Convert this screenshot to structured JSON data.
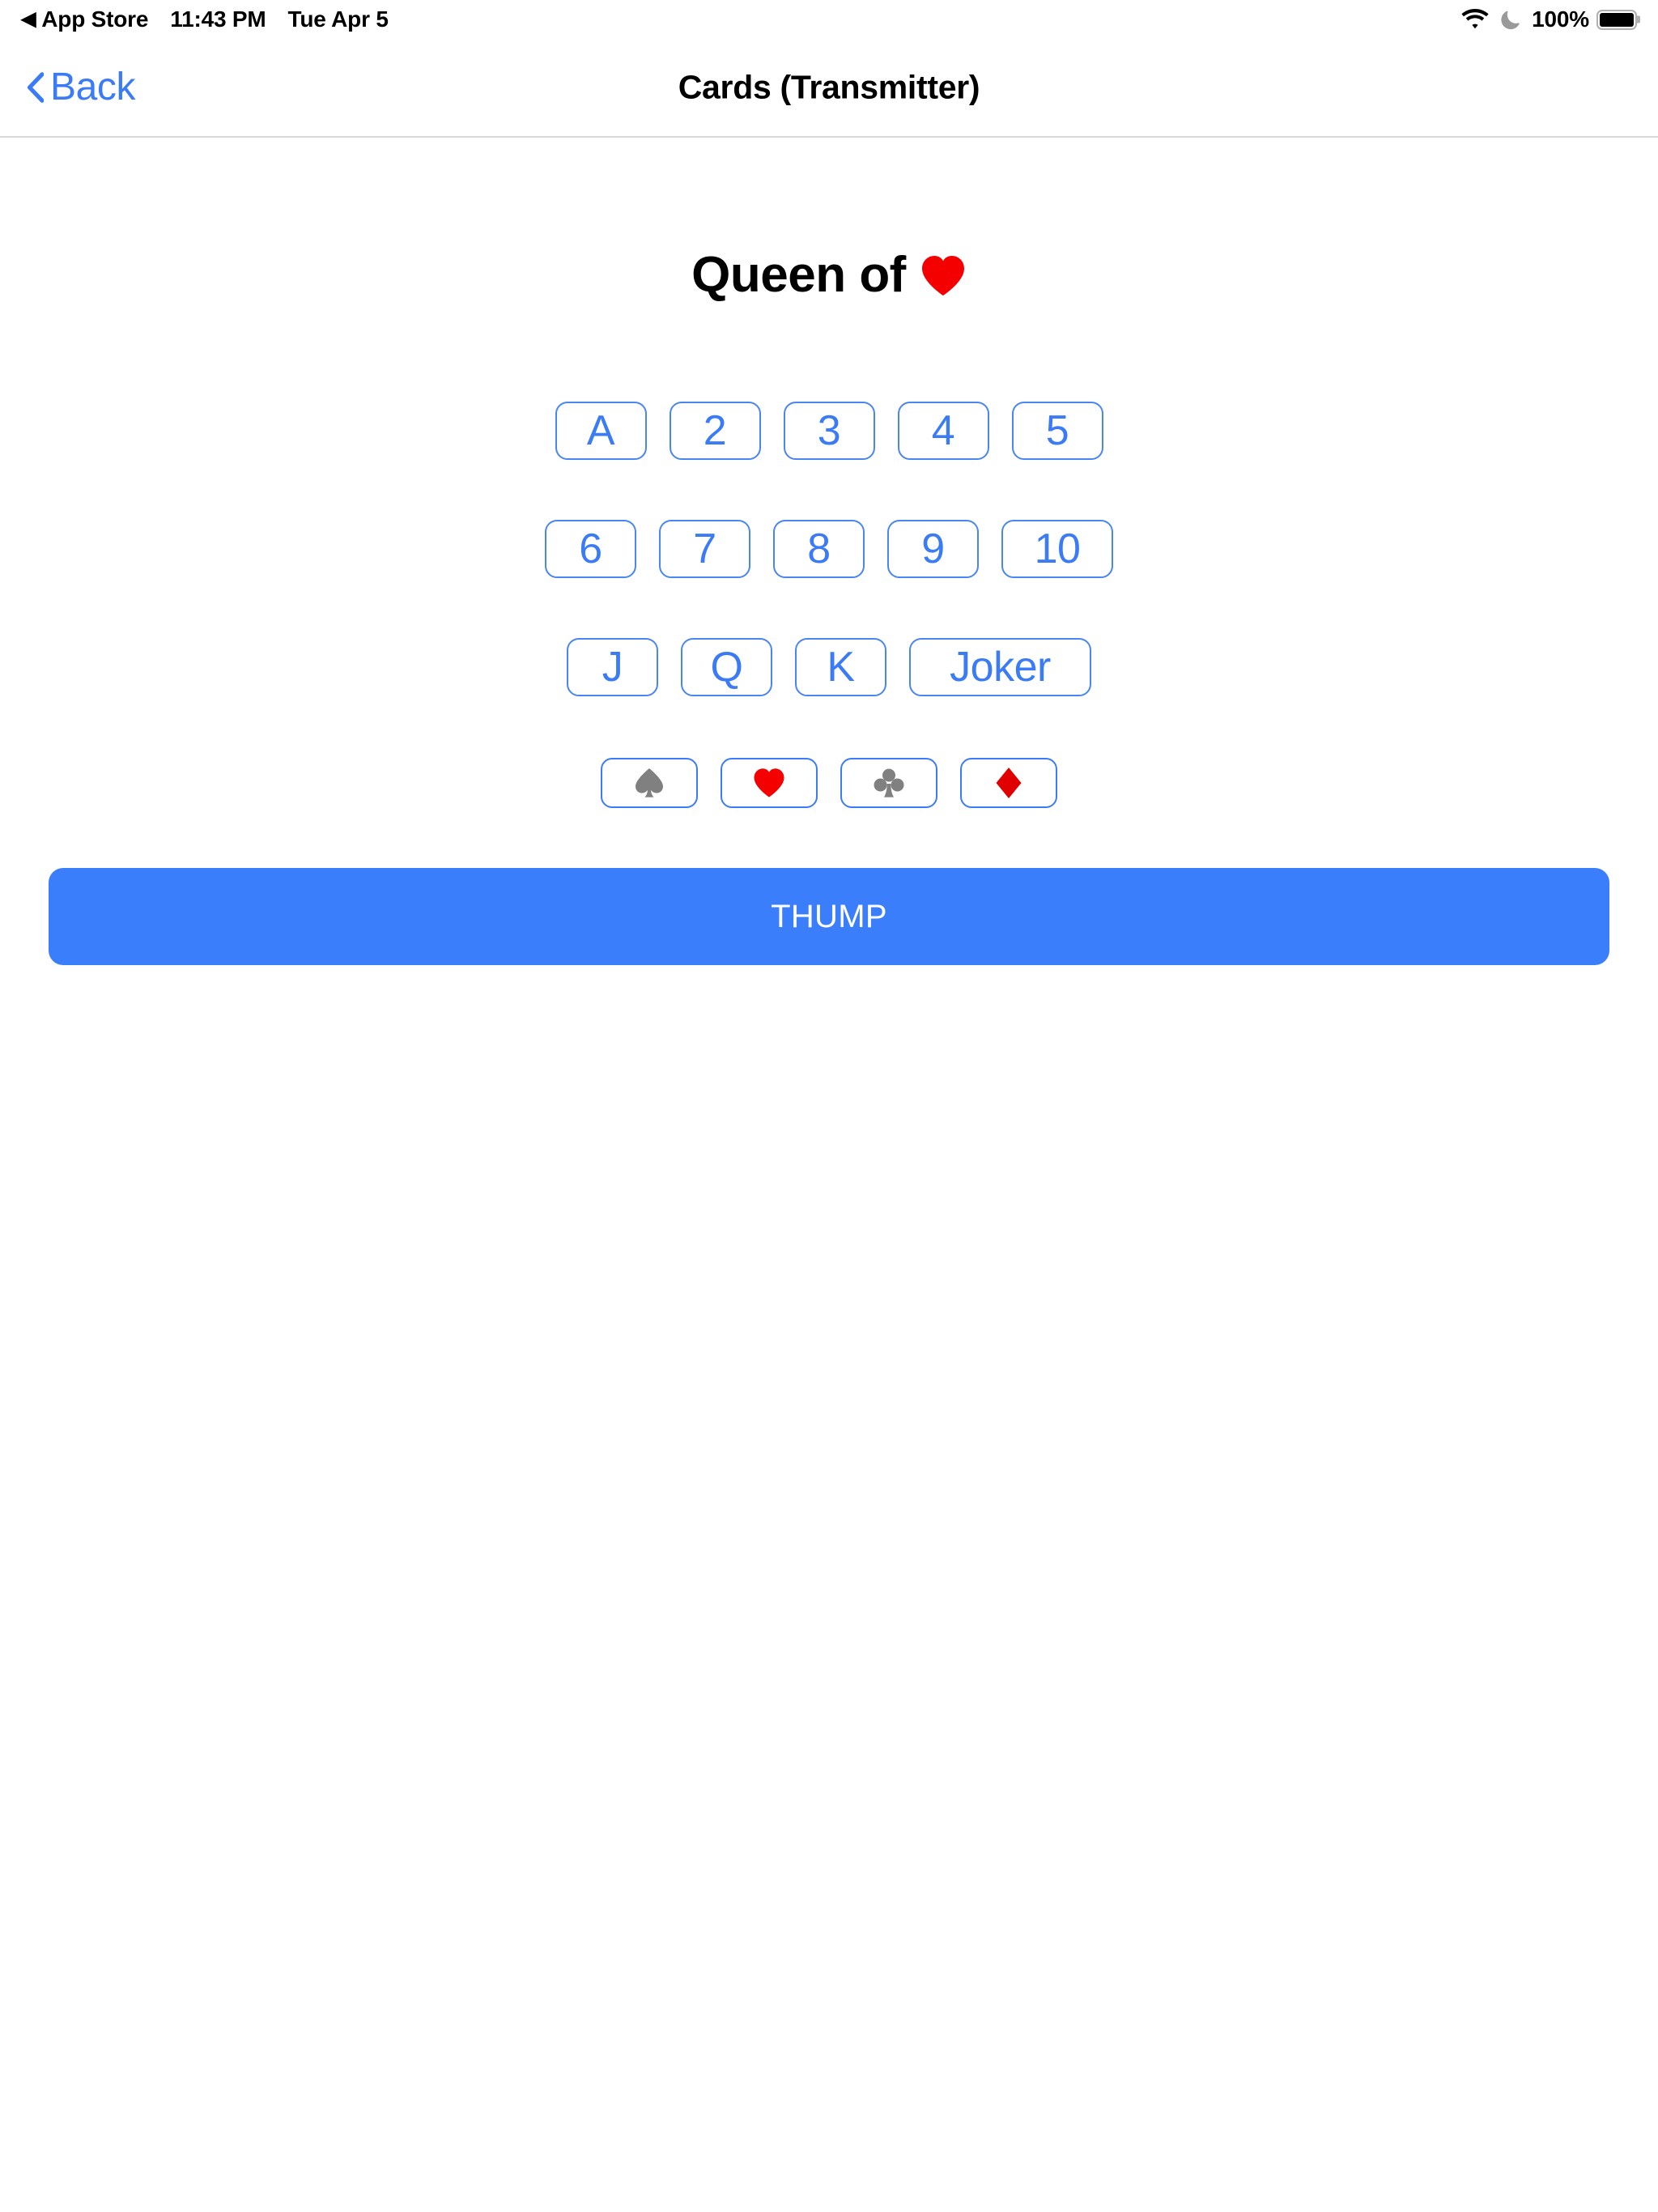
{
  "status_bar": {
    "back_arrow": "◀",
    "app_name": "App Store",
    "time": "11:43 PM",
    "date": "Tue Apr 5",
    "wifi_icon": "wifi-icon",
    "dnd_icon": "moon-icon",
    "battery_percent": "100%",
    "battery_icon": "battery-full-icon"
  },
  "nav_bar": {
    "back_icon": "chevron-left-icon",
    "back_label": "Back",
    "title": "Cards (Transmitter)"
  },
  "main": {
    "headline_text": "Queen of",
    "headline_suit": "heart-suit-icon",
    "rank_rows": [
      {
        "buttons": [
          {
            "label": "A",
            "name": "rank-button-a",
            "width": "normal"
          },
          {
            "label": "2",
            "name": "rank-button-2",
            "width": "normal"
          },
          {
            "label": "3",
            "name": "rank-button-3",
            "width": "normal"
          },
          {
            "label": "4",
            "name": "rank-button-4",
            "width": "normal"
          },
          {
            "label": "5",
            "name": "rank-button-5",
            "width": "normal"
          }
        ]
      },
      {
        "buttons": [
          {
            "label": "6",
            "name": "rank-button-6",
            "width": "normal"
          },
          {
            "label": "7",
            "name": "rank-button-7",
            "width": "normal"
          },
          {
            "label": "8",
            "name": "rank-button-8",
            "width": "normal"
          },
          {
            "label": "9",
            "name": "rank-button-9",
            "width": "normal"
          },
          {
            "label": "10",
            "name": "rank-button-10",
            "width": "wide"
          }
        ]
      },
      {
        "buttons": [
          {
            "label": "J",
            "name": "rank-button-j",
            "width": "normal"
          },
          {
            "label": "Q",
            "name": "rank-button-q",
            "width": "normal"
          },
          {
            "label": "K",
            "name": "rank-button-k",
            "width": "normal"
          },
          {
            "label": "Joker",
            "name": "rank-button-joker",
            "width": "joker"
          }
        ]
      }
    ],
    "suit_buttons": [
      {
        "icon": "spade-suit-icon",
        "name": "suit-button-spade",
        "color": "#808080"
      },
      {
        "icon": "heart-suit-icon",
        "name": "suit-button-heart",
        "color": "#f40000"
      },
      {
        "icon": "club-suit-icon",
        "name": "suit-button-club",
        "color": "#808080"
      },
      {
        "icon": "diamond-suit-icon",
        "name": "suit-button-diamond",
        "color": "#e00000"
      }
    ],
    "thump_label": "THUMP"
  },
  "colors": {
    "accent_blue": "#3b7cf6",
    "button_blue": "#3b7efb",
    "border_blue": "#4a86f0",
    "suit_red": "#f40000",
    "suit_gray": "#808080",
    "separator": "#d8d8d8",
    "background": "#ffffff",
    "text_black": "#000000"
  }
}
